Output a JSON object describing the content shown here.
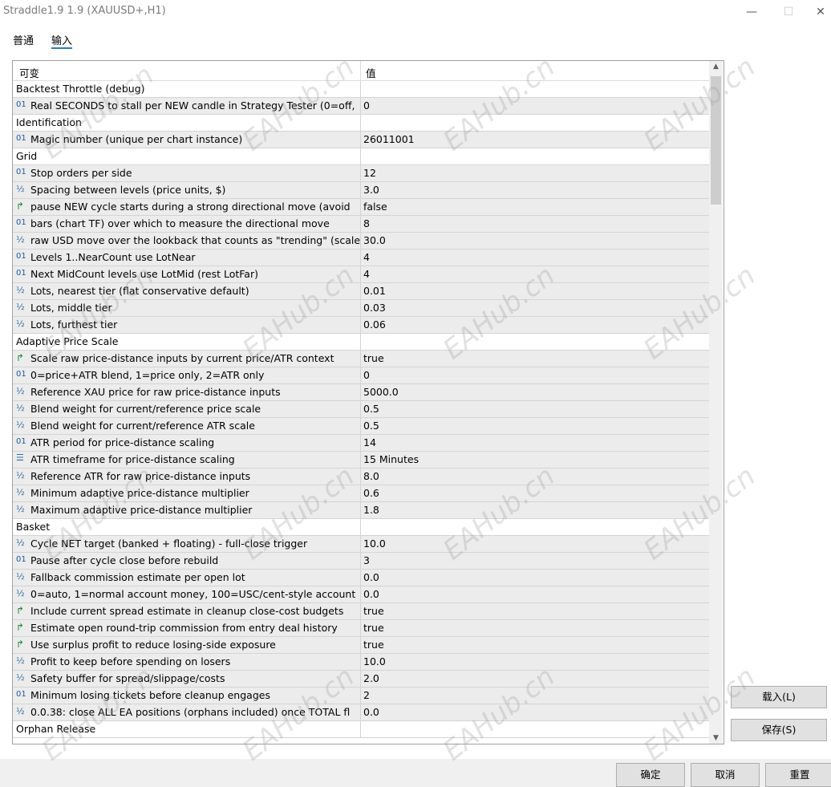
{
  "window": {
    "title": "Straddle1.9 1.9 (XAUUSD+,H1)",
    "min_glyph": "—",
    "max_glyph": "☐",
    "close_glyph": "✕"
  },
  "tabs": [
    {
      "label": "普通"
    },
    {
      "label": "输入"
    }
  ],
  "grid": {
    "col_variable": "可变",
    "col_value": "值",
    "rows": [
      {
        "kind": "group",
        "name": "Backtest Throttle (debug)",
        "value": ""
      },
      {
        "kind": "param",
        "type": "int",
        "icon": "01",
        "name": "Real SECONDS to stall per NEW candle in Strategy Tester (0=off,",
        "value": "0"
      },
      {
        "kind": "group",
        "name": "Identification",
        "value": ""
      },
      {
        "kind": "param",
        "type": "int",
        "icon": "01",
        "name": "Magic number (unique per chart instance)",
        "value": "26011001"
      },
      {
        "kind": "group",
        "name": "Grid",
        "value": ""
      },
      {
        "kind": "param",
        "type": "int",
        "icon": "01",
        "name": "Stop orders per side",
        "value": "12"
      },
      {
        "kind": "param",
        "type": "double",
        "icon": "½",
        "name": "Spacing between levels (price units, $)",
        "value": "3.0"
      },
      {
        "kind": "param",
        "type": "bool",
        "icon": "↱",
        "name": "pause NEW cycle starts during a strong directional move (avoid",
        "value": "false"
      },
      {
        "kind": "param",
        "type": "int",
        "icon": "01",
        "name": "bars (chart TF) over which to measure the directional move",
        "value": "8"
      },
      {
        "kind": "param",
        "type": "double",
        "icon": "½",
        "name": "raw USD move over the lookback that counts as \"trending\" (scale",
        "value": "30.0"
      },
      {
        "kind": "param",
        "type": "int",
        "icon": "01",
        "name": "Levels 1..NearCount use LotNear",
        "value": "4"
      },
      {
        "kind": "param",
        "type": "int",
        "icon": "01",
        "name": "Next MidCount levels use LotMid (rest LotFar)",
        "value": "4"
      },
      {
        "kind": "param",
        "type": "double",
        "icon": "½",
        "name": "Lots, nearest tier (flat conservative default)",
        "value": "0.01"
      },
      {
        "kind": "param",
        "type": "double",
        "icon": "½",
        "name": "Lots, middle tier",
        "value": "0.03"
      },
      {
        "kind": "param",
        "type": "double",
        "icon": "½",
        "name": "Lots, furthest tier",
        "value": "0.06"
      },
      {
        "kind": "group",
        "name": "Adaptive Price Scale",
        "value": ""
      },
      {
        "kind": "param",
        "type": "bool",
        "icon": "↱",
        "name": "Scale raw price-distance inputs by current price/ATR context",
        "value": "true"
      },
      {
        "kind": "param",
        "type": "int",
        "icon": "01",
        "name": "0=price+ATR blend, 1=price only, 2=ATR only",
        "value": "0"
      },
      {
        "kind": "param",
        "type": "double",
        "icon": "½",
        "name": "Reference XAU price for raw price-distance inputs",
        "value": "5000.0"
      },
      {
        "kind": "param",
        "type": "double",
        "icon": "½",
        "name": "Blend weight for current/reference price scale",
        "value": "0.5"
      },
      {
        "kind": "param",
        "type": "double",
        "icon": "½",
        "name": "Blend weight for current/reference ATR scale",
        "value": "0.5"
      },
      {
        "kind": "param",
        "type": "int",
        "icon": "01",
        "name": "ATR period for price-distance scaling",
        "value": "14"
      },
      {
        "kind": "param",
        "type": "enum",
        "icon": "☰",
        "name": "ATR timeframe for price-distance scaling",
        "value": "15 Minutes"
      },
      {
        "kind": "param",
        "type": "double",
        "icon": "½",
        "name": "Reference ATR for raw price-distance inputs",
        "value": "8.0"
      },
      {
        "kind": "param",
        "type": "double",
        "icon": "½",
        "name": "Minimum adaptive price-distance multiplier",
        "value": "0.6"
      },
      {
        "kind": "param",
        "type": "double",
        "icon": "½",
        "name": "Maximum adaptive price-distance multiplier",
        "value": "1.8"
      },
      {
        "kind": "group",
        "name": "Basket",
        "value": ""
      },
      {
        "kind": "param",
        "type": "double",
        "icon": "½",
        "name": "Cycle NET target (banked + floating) - full-close trigger",
        "value": "10.0"
      },
      {
        "kind": "param",
        "type": "int",
        "icon": "01",
        "name": "Pause after cycle close before rebuild",
        "value": "3"
      },
      {
        "kind": "param",
        "type": "double",
        "icon": "½",
        "name": "Fallback commission estimate per open lot",
        "value": "0.0"
      },
      {
        "kind": "param",
        "type": "double",
        "icon": "½",
        "name": "0=auto, 1=normal account money, 100=USC/cent-style account",
        "value": "0.0"
      },
      {
        "kind": "param",
        "type": "bool",
        "icon": "↱",
        "name": "Include current spread estimate in cleanup close-cost budgets",
        "value": "true"
      },
      {
        "kind": "param",
        "type": "bool",
        "icon": "↱",
        "name": "Estimate open round-trip commission from entry deal history",
        "value": "true"
      },
      {
        "kind": "param",
        "type": "bool",
        "icon": "↱",
        "name": "Use surplus profit to reduce losing-side exposure",
        "value": "true"
      },
      {
        "kind": "param",
        "type": "double",
        "icon": "½",
        "name": "Profit to keep before spending on losers",
        "value": "10.0"
      },
      {
        "kind": "param",
        "type": "double",
        "icon": "½",
        "name": "Safety buffer for spread/slippage/costs",
        "value": "2.0"
      },
      {
        "kind": "param",
        "type": "int",
        "icon": "01",
        "name": "Minimum losing tickets before cleanup engages",
        "value": "2"
      },
      {
        "kind": "param",
        "type": "double",
        "icon": "½",
        "name": "0.0.38: close ALL EA positions (orphans included) once TOTAL fl",
        "value": "0.0"
      },
      {
        "kind": "group",
        "name": "Orphan Release",
        "value": ""
      }
    ]
  },
  "side_buttons": {
    "load_label": "载入(L)",
    "save_label": "保存(S)"
  },
  "bottom_buttons": {
    "ok_label": "确定",
    "cancel_label": "取消",
    "reset_label": "重置"
  },
  "scrollbar": {
    "up_glyph": "▲",
    "down_glyph": "▼"
  },
  "watermark": "EAHub.cn"
}
